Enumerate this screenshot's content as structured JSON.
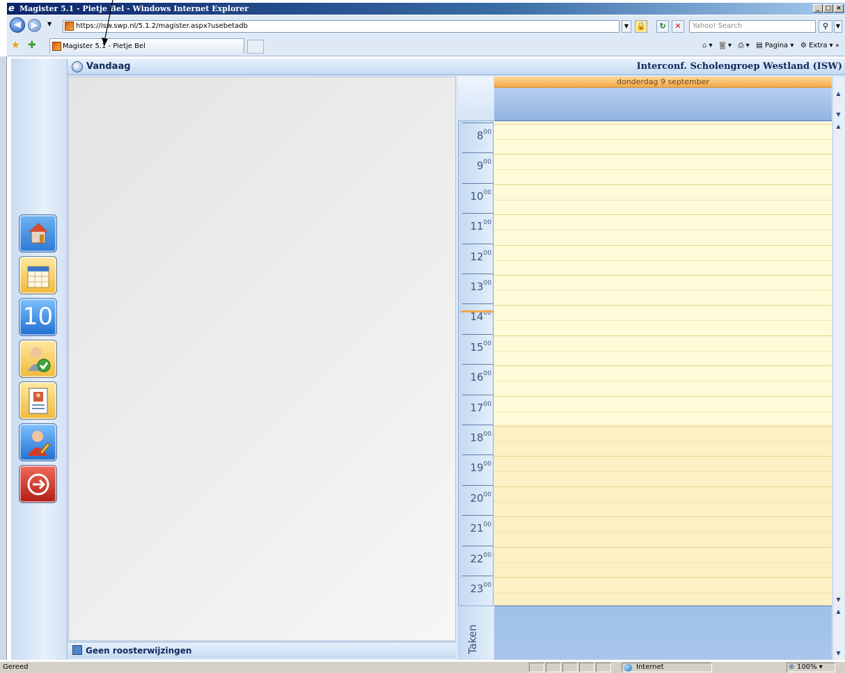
{
  "window": {
    "title": "Magister 5.1 - Pietje Bel - Windows Internet Explorer",
    "minimize": "_",
    "maximize": "□",
    "close": "×"
  },
  "browser": {
    "back": "◀",
    "forward": "▶",
    "address": "https://isw.swp.nl/5.1.2/magister.aspx?usebetadb",
    "search_placeholder": "Yahoo! Search",
    "tab_label": "Magister 5.1 - Pietje Bel",
    "command_bar": {
      "page_label": "Pagina",
      "tools_label": "Extra"
    }
  },
  "app": {
    "header_title": "Vandaag",
    "organization": "Interconf. Scholengroep Westland (ISW)",
    "bottom_label": "Geen roosterwijzingen",
    "sidebar_icons": [
      "home-icon",
      "agenda-icon",
      "grades-icon",
      "attendance-icon",
      "profile-icon",
      "settings-icon",
      "logout-icon"
    ],
    "sidebar_badge": "10"
  },
  "calendar": {
    "day_label": "donderdag 9 september",
    "hours": [
      {
        "h": "8",
        "m": "00"
      },
      {
        "h": "9",
        "m": "00"
      },
      {
        "h": "10",
        "m": "00"
      },
      {
        "h": "11",
        "m": "00"
      },
      {
        "h": "12",
        "m": "00"
      },
      {
        "h": "13",
        "m": "00"
      },
      {
        "h": "14",
        "m": "00"
      },
      {
        "h": "15",
        "m": "00"
      },
      {
        "h": "16",
        "m": "00"
      },
      {
        "h": "17",
        "m": "00"
      },
      {
        "h": "18",
        "m": "00"
      },
      {
        "h": "19",
        "m": "00"
      },
      {
        "h": "20",
        "m": "00"
      },
      {
        "h": "21",
        "m": "00"
      },
      {
        "h": "22",
        "m": "00"
      },
      {
        "h": "23",
        "m": "00"
      }
    ],
    "tasks_label": "Taken"
  },
  "statusbar": {
    "status": "Gereed",
    "zone": "Internet",
    "zoom": "100%"
  },
  "colors": {
    "title_bar": "#0a246a",
    "day_header": "#f4a94a",
    "day_grid": "#fffbd9",
    "app_text": "#0e2a5a"
  }
}
